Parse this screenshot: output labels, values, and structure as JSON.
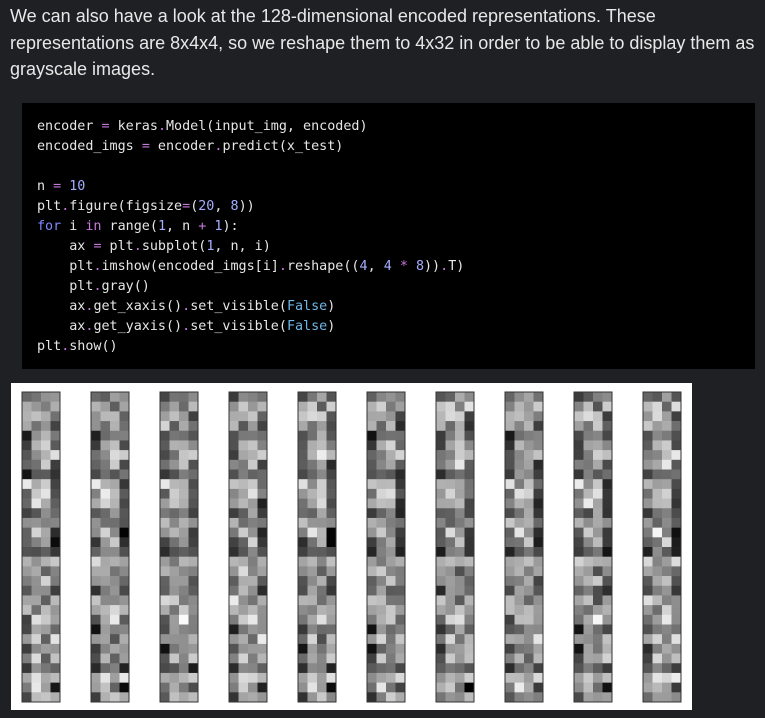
{
  "paragraph": "We can also have a look at the 128-dimensional encoded representations. These representations are 8x4x4, so we reshape them to 4x32 in order to be able to display them as grayscale images.",
  "code": {
    "l1": {
      "a": "encoder ",
      "b": "=",
      "c": " keras",
      "d": ".",
      "e": "Model(input_img, encoded)"
    },
    "l2": {
      "a": "encoded_imgs ",
      "b": "=",
      "c": " encoder",
      "d": ".",
      "e": "predict(x_test)"
    },
    "l4": {
      "a": "n ",
      "b": "=",
      "c": " ",
      "d": "10"
    },
    "l5": {
      "a": "plt",
      "b": ".",
      "c": "figure(figsize",
      "d": "=",
      "e": "(",
      "f": "20",
      "g": ", ",
      "h": "8",
      "i": "))"
    },
    "l6": {
      "a": "for",
      "b": " i ",
      "c": "in",
      "d": " range(",
      "e": "1",
      "f": ", n ",
      "g": "+",
      "h": " ",
      "i": "1",
      "j": "):"
    },
    "l7": {
      "a": "    ax ",
      "b": "=",
      "c": " plt",
      "d": ".",
      "e": "subplot(",
      "f": "1",
      "g": ", n, i)"
    },
    "l8": {
      "a": "    plt",
      "b": ".",
      "c": "imshow(encoded_imgs[i]",
      "d": ".",
      "e": "reshape((",
      "f": "4",
      "g": ", ",
      "h": "4",
      "i": " ",
      "j": "*",
      "k": " ",
      "l": "8",
      "m": "))",
      "n": ".",
      "o": "T)"
    },
    "l9": {
      "a": "    plt",
      "b": ".",
      "c": "gray()"
    },
    "l10": {
      "a": "    ax",
      "b": ".",
      "c": "get_xaxis()",
      "d": ".",
      "e": "set_visible(",
      "f": "False",
      "g": ")"
    },
    "l11": {
      "a": "    ax",
      "b": ".",
      "c": "get_yaxis()",
      "d": ".",
      "e": "set_visible(",
      "f": "False",
      "g": ")"
    },
    "l12": {
      "a": "plt",
      "b": ".",
      "c": "show()"
    }
  },
  "figure": {
    "panel_count": 10,
    "grid": {
      "cols": 4,
      "rows": 32
    },
    "colors": {
      "background": "#ffffff",
      "frame": "#333333"
    }
  }
}
